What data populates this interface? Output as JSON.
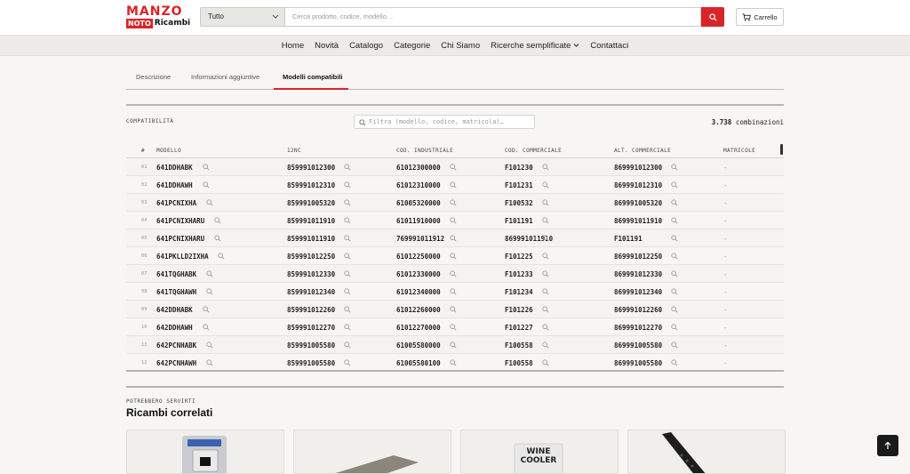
{
  "brand": {
    "logo_line1": "MANZO",
    "logo_line2_red": "NOTO",
    "logo_line2_black": "Ricambi"
  },
  "search": {
    "category_selected": "Tutto",
    "placeholder": "Cerca prodotto, codice, modello…"
  },
  "cart": {
    "label": "Carrello"
  },
  "nav": {
    "items": [
      "Home",
      "Novità",
      "Catalogo",
      "Categorie",
      "Chi Siamo",
      "Ricerche semplificate",
      "Contattaci"
    ]
  },
  "tabs": [
    {
      "label": "Descrizione",
      "active": false
    },
    {
      "label": "Informazioni aggiuntive",
      "active": false
    },
    {
      "label": "Modelli compatibili",
      "active": true
    }
  ],
  "compat": {
    "section_label": "COMPATIBILITÀ",
    "filter_placeholder": "Filtra (modello, codice, matricola)…",
    "count": "3.738",
    "count_suffix": "combinazioni"
  },
  "table": {
    "headers": [
      "#",
      "MODELLO",
      "12NC",
      "COD. INDUSTRIALE",
      "COD. COMMERCIALE",
      "ALT. COMMERCIALE",
      "MATRICOLE"
    ],
    "rows": [
      [
        "01",
        "641DDHABK",
        "859991012300",
        "61012300000",
        "F101230",
        "869991012300",
        "-"
      ],
      [
        "02",
        "641DDHAWH",
        "859991012310",
        "61012310000",
        "F101231",
        "869991012310",
        "-"
      ],
      [
        "03",
        "641PCNIXHA",
        "859991005320",
        "61005320000",
        "F100532",
        "869991005320",
        "-"
      ],
      [
        "04",
        "641PCNIXHARU",
        "859991011910",
        "61011910000",
        "F101191",
        "869991011910",
        "-"
      ],
      [
        "05",
        "641PCNIXHARU",
        "859991011910",
        "769991011912",
        "869991011910",
        "F101191",
        "-"
      ],
      [
        "06",
        "641PKLLD2IXHA",
        "859991012250",
        "61012250000",
        "F101225",
        "869991012250",
        "-"
      ],
      [
        "07",
        "641TQGHABK",
        "859991012330",
        "61012330000",
        "F101233",
        "869991012330",
        "-"
      ],
      [
        "08",
        "641TQGHAWH",
        "859991012340",
        "61012340000",
        "F101234",
        "869991012340",
        "-"
      ],
      [
        "09",
        "642DDHABK",
        "859991012260",
        "61012260000",
        "F101226",
        "869991012260",
        "-"
      ],
      [
        "10",
        "642DDHAWH",
        "859991012270",
        "61012270000",
        "F101227",
        "869991012270",
        "-"
      ],
      [
        "11",
        "642PCNHABK",
        "859991005580",
        "61005580000",
        "F100558",
        "869991005580",
        "-"
      ],
      [
        "12",
        "642PCNHAWH",
        "859991005580",
        "61005580100",
        "F100558",
        "869991005580",
        "-"
      ]
    ]
  },
  "related": {
    "eyebrow": "POTREBBERO SERVIRTI",
    "title": "Ricambi correlati",
    "card3_text_line1": "WINE",
    "card3_text_line2": "COOLER"
  },
  "colors": {
    "accent": "#d8252a",
    "background": "#f7f6f4"
  }
}
